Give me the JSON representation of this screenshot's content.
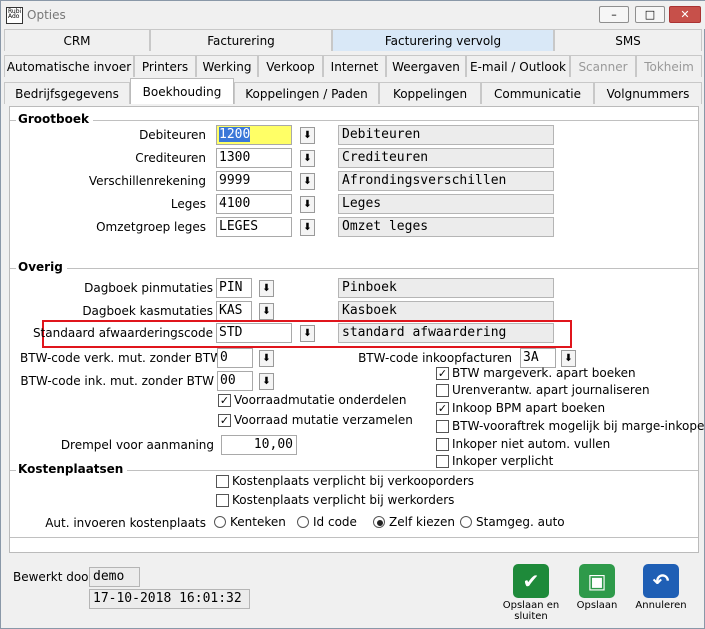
{
  "window": {
    "title": "Opties",
    "min": "–",
    "max": "□",
    "close": "✕",
    "icon_text": "Rubi Ado"
  },
  "tabs_row1": [
    "CRM",
    "Facturering",
    "Facturering vervolg",
    "SMS"
  ],
  "tabs_row2": [
    "Automatische invoer",
    "Printers",
    "Werking",
    "Verkoop",
    "Internet",
    "Weergaven",
    "E-mail / Outlook",
    "Scanner",
    "Tokheim"
  ],
  "tabs_row3": [
    "Bedrijfsgegevens",
    "Boekhouding",
    "Koppelingen / Paden",
    "Koppelingen",
    "Communicatie",
    "Volgnummers"
  ],
  "grootboek": {
    "title": "Grootboek",
    "rows": [
      {
        "label": "Debiteuren",
        "code": "1200",
        "desc": "Debiteuren"
      },
      {
        "label": "Crediteuren",
        "code": "1300",
        "desc": "Crediteuren"
      },
      {
        "label": "Verschillenrekening",
        "code": "9999",
        "desc": "Afrondingsverschillen"
      },
      {
        "label": "Leges",
        "code": "4100",
        "desc": "Leges"
      },
      {
        "label": "Omzetgroep leges",
        "code": "LEGES",
        "desc": "Omzet leges"
      }
    ]
  },
  "overig": {
    "title": "Overig",
    "rows": [
      {
        "label": "Dagboek pinmutaties",
        "code": "PIN",
        "desc": "Pinboek"
      },
      {
        "label": "Dagboek kasmutaties",
        "code": "KAS",
        "desc": "Kasboek"
      },
      {
        "label": "Standaard afwaarderingscode",
        "code": "STD",
        "desc": "standard afwaardering"
      }
    ],
    "btw_verk_label": "BTW-code verk. mut. zonder BTW",
    "btw_verk_value": "0",
    "btw_ink_label": "BTW-code ink. mut. zonder BTW",
    "btw_ink_value": "00",
    "btw_inkoop_label": "BTW-code inkoopfacturen",
    "btw_inkoop_value": "3A",
    "voorraad1": "Voorraadmutatie onderdelen",
    "voorraad2": "Voorraad mutatie verzamelen",
    "drempel_label": "Drempel voor aanmaning",
    "drempel_value": "10,00",
    "right_checks": [
      {
        "label": "BTW margeverk. apart boeken",
        "checked": true
      },
      {
        "label": "Urenverantw. apart journaliseren",
        "checked": false
      },
      {
        "label": "Inkoop BPM apart boeken",
        "checked": true
      },
      {
        "label": "BTW-vooraftrek mogelijk bij marge-inkopen",
        "checked": false
      },
      {
        "label": "Inkoper niet autom. vullen",
        "checked": false
      },
      {
        "label": "Inkoper verplicht",
        "checked": false
      }
    ]
  },
  "kostenplaatsen": {
    "title": "Kostenplaatsen",
    "check1": "Kostenplaats verplicht bij verkooporders",
    "check2": "Kostenplaats verplicht bij werkorders",
    "aut_label": "Aut. invoeren kostenplaats",
    "radios": [
      "Kenteken",
      "Id code",
      "Zelf kiezen",
      "Stamgeg. auto"
    ],
    "selected": "Zelf kiezen"
  },
  "footer": {
    "bewerkt_label": "Bewerkt door",
    "bewerkt_user": "demo",
    "bewerkt_date": "17-10-2018 16:01:32",
    "btn_save_close": "Opslaan en sluiten",
    "btn_save": "Opslaan",
    "btn_cancel": "Annuleren"
  },
  "colors": {
    "highlight": "#ffff66",
    "accent": "#3b78d8",
    "red_box": "#e0151c"
  }
}
